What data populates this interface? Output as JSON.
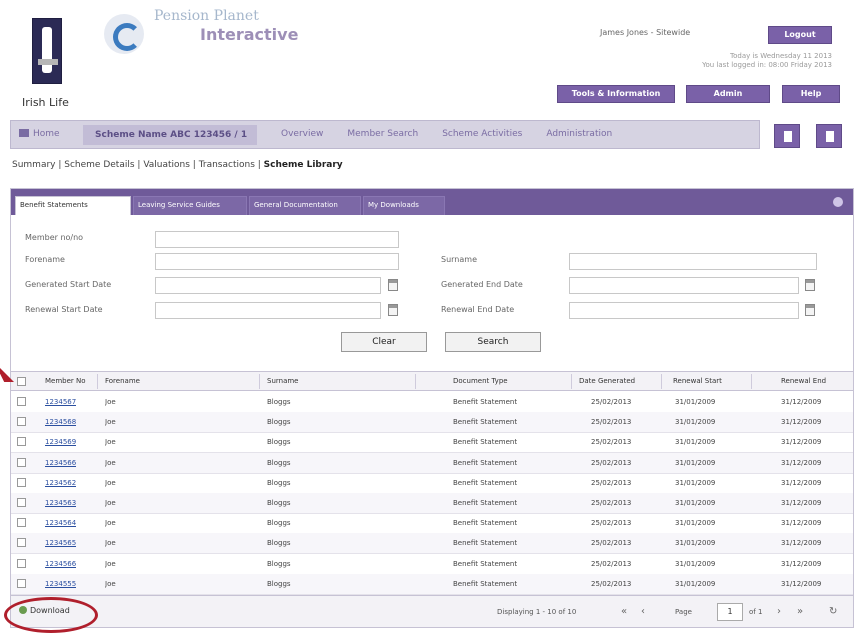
{
  "header": {
    "brand_name": "Irish Life",
    "portal_title": "Pension Planet",
    "portal_subtitle": "Interactive",
    "user_line": "James Jones - Sitewide",
    "login_info": "Today is Wednesday 11 2013\nYou last logged in: 08:00 Friday 2013",
    "buttons": {
      "logout": "Logout",
      "tools": "Tools & Information",
      "admin": "Admin",
      "help": "Help"
    }
  },
  "nav": {
    "home": "Home",
    "scheme": "Scheme Name ABC 123456 / 1",
    "links": [
      "Overview",
      "Member Search",
      "Scheme Activities",
      "Administration"
    ],
    "icons": [
      "print-icon",
      "export-icon"
    ]
  },
  "subnav": {
    "items": [
      "Summary",
      "Scheme Details",
      "Valuations",
      "Transactions"
    ],
    "active": "Scheme Library",
    "separator": " | "
  },
  "tabs": [
    {
      "label": "Benefit Statements",
      "active": true
    },
    {
      "label": "Leaving Service Guides",
      "active": false
    },
    {
      "label": "General Documentation",
      "active": false
    },
    {
      "label": "My Downloads",
      "active": false
    }
  ],
  "form": {
    "member_no": {
      "label": "Member no/no",
      "value": ""
    },
    "forename": {
      "label": "Forename",
      "value": ""
    },
    "surname": {
      "label": "Surname",
      "value": ""
    },
    "gen_start": {
      "label": "Generated Start Date",
      "value": ""
    },
    "gen_end": {
      "label": "Generated End Date",
      "value": ""
    },
    "ren_start": {
      "label": "Renewal Start Date",
      "value": ""
    },
    "ren_end": {
      "label": "Renewal End Date",
      "value": ""
    },
    "clear_label": "Clear",
    "search_label": "Search"
  },
  "table": {
    "columns": [
      "Member No",
      "Forename",
      "Surname",
      "Document Type",
      "Date Generated",
      "Renewal Start",
      "Renewal End"
    ],
    "rows": [
      [
        "1234567",
        "Joe",
        "Bloggs",
        "Benefit Statement",
        "25/02/2013",
        "31/01/2009",
        "31/12/2009"
      ],
      [
        "1234568",
        "Joe",
        "Bloggs",
        "Benefit Statement",
        "25/02/2013",
        "31/01/2009",
        "31/12/2009"
      ],
      [
        "1234569",
        "Joe",
        "Bloggs",
        "Benefit Statement",
        "25/02/2013",
        "31/01/2009",
        "31/12/2009"
      ],
      [
        "1234566",
        "Joe",
        "Bloggs",
        "Benefit Statement",
        "25/02/2013",
        "31/01/2009",
        "31/12/2009"
      ],
      [
        "1234562",
        "Joe",
        "Bloggs",
        "Benefit Statement",
        "25/02/2013",
        "31/01/2009",
        "31/12/2009"
      ],
      [
        "1234563",
        "Joe",
        "Bloggs",
        "Benefit Statement",
        "25/02/2013",
        "31/01/2009",
        "31/12/2009"
      ],
      [
        "1234564",
        "Joe",
        "Bloggs",
        "Benefit Statement",
        "25/02/2013",
        "31/01/2009",
        "31/12/2009"
      ],
      [
        "1234565",
        "Joe",
        "Bloggs",
        "Benefit Statement",
        "25/02/2013",
        "31/01/2009",
        "31/12/2009"
      ],
      [
        "1234566",
        "Joe",
        "Bloggs",
        "Benefit Statement",
        "25/02/2013",
        "31/01/2009",
        "31/12/2009"
      ],
      [
        "1234555",
        "Joe",
        "Bloggs",
        "Benefit Statement",
        "25/02/2013",
        "31/01/2009",
        "31/12/2009"
      ]
    ]
  },
  "footer": {
    "download_label": "Download",
    "displaying": "Displaying 1 - 10 of 10",
    "page_label": "Page",
    "page_value": "1",
    "of_label": "of 1"
  },
  "colors": {
    "accent": "#7a61a8",
    "tabbar": "#6f5a99",
    "annotation": "#b01f2c"
  }
}
